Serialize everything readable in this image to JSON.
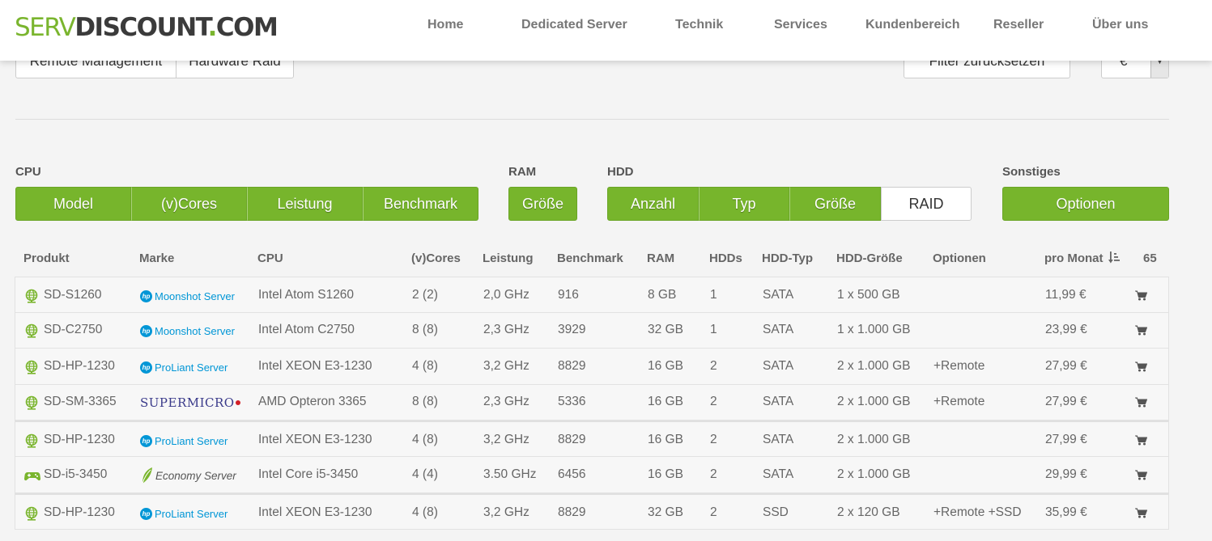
{
  "logo": {
    "part1": "SERV",
    "part2": "DISCOUNT",
    "part3": ".",
    "part4": "COM"
  },
  "nav": [
    "Home",
    "Dedicated Server",
    "Technik",
    "Services",
    "Kundenbereich",
    "Reseller",
    "Über uns"
  ],
  "top_filters": {
    "remote": "Remote Management",
    "raid": "Hardware Raid",
    "reset": "Filter zurücksetzen",
    "currency": "€"
  },
  "groups": {
    "cpu": "CPU",
    "ram": "RAM",
    "hdd": "HDD",
    "misc": "Sonstiges"
  },
  "buttons": {
    "cpu": [
      "Model",
      "(v)Cores",
      "Leistung",
      "Benchmark"
    ],
    "ram": [
      "Größe"
    ],
    "hdd": [
      "Anzahl",
      "Typ",
      "Größe",
      "RAID"
    ],
    "misc": [
      "Optionen"
    ]
  },
  "table": {
    "headers": {
      "produkt": "Produkt",
      "marke": "Marke",
      "cpu": "CPU",
      "cores": "(v)Cores",
      "leistung": "Leistung",
      "benchmark": "Benchmark",
      "ram": "RAM",
      "hdds": "HDDs",
      "hddtyp": "HDD-Typ",
      "hddgroesse": "HDD-Größe",
      "optionen": "Optionen",
      "preis": "pro Monat",
      "count": "65"
    },
    "rows": [
      {
        "icon": "globe-icon",
        "name": "SD-S1260",
        "brand_type": "hp",
        "brand": "Moonshot Server",
        "cpu": "Intel Atom S1260",
        "cores": "2 (2)",
        "leistung": "2,0 GHz",
        "benchmark": "916",
        "ram": "8 GB",
        "hdds": "1",
        "hddtyp": "SATA",
        "hddgroesse": "1 x 500 GB",
        "optionen": "",
        "preis": "11,99 €"
      },
      {
        "icon": "globe-icon",
        "name": "SD-C2750",
        "brand_type": "hp",
        "brand": "Moonshot Server",
        "cpu": "Intel Atom C2750",
        "cores": "8 (8)",
        "leistung": "2,3 GHz",
        "benchmark": "3929",
        "ram": "32 GB",
        "hdds": "1",
        "hddtyp": "SATA",
        "hddgroesse": "1 x 1.000 GB",
        "optionen": "",
        "preis": "23,99 €"
      },
      {
        "icon": "globe-icon",
        "name": "SD-HP-1230",
        "brand_type": "hp",
        "brand": "ProLiant Server",
        "cpu": "Intel XEON E3-1230",
        "cores": "4 (8)",
        "leistung": "3,2 GHz",
        "benchmark": "8829",
        "ram": "16 GB",
        "hdds": "2",
        "hddtyp": "SATA",
        "hddgroesse": "2 x 1.000 GB",
        "optionen": "+Remote",
        "preis": "27,99 €"
      },
      {
        "icon": "globe-icon",
        "name": "SD-SM-3365",
        "brand_type": "sm",
        "brand": "SUPERMICRO",
        "cpu": "AMD Opteron 3365",
        "cores": "8 (8)",
        "leistung": "2,3 GHz",
        "benchmark": "5336",
        "ram": "16 GB",
        "hdds": "2",
        "hddtyp": "SATA",
        "hddgroesse": "2 x 1.000 GB",
        "optionen": "+Remote",
        "preis": "27,99 €"
      },
      {
        "icon": "globe-icon",
        "name": "SD-HP-1230",
        "brand_type": "hp",
        "brand": "ProLiant Server",
        "cpu": "Intel XEON E3-1230",
        "cores": "4 (8)",
        "leistung": "3,2 GHz",
        "benchmark": "8829",
        "ram": "16 GB",
        "hdds": "2",
        "hddtyp": "SATA",
        "hddgroesse": "2 x 1.000 GB",
        "optionen": "",
        "preis": "27,99 €"
      },
      {
        "icon": "gamepad-icon",
        "name": "SD-i5-3450",
        "brand_type": "eco",
        "brand": "Economy Server",
        "cpu": "Intel Core i5-3450",
        "cores": "4 (4)",
        "leistung": "3.50 GHz",
        "benchmark": "6456",
        "ram": "16 GB",
        "hdds": "2",
        "hddtyp": "SATA",
        "hddgroesse": "2 x 1.000 GB",
        "optionen": "",
        "preis": "29,99 €"
      },
      {
        "icon": "globe-icon",
        "name": "SD-HP-1230",
        "brand_type": "hp",
        "brand": "ProLiant Server",
        "cpu": "Intel XEON E3-1230",
        "cores": "4 (8)",
        "leistung": "3,2 GHz",
        "benchmark": "8829",
        "ram": "32 GB",
        "hdds": "2",
        "hddtyp": "SSD",
        "hddgroesse": "2 x 120 GB",
        "optionen": "+Remote +SSD",
        "preis": "35,99 €"
      }
    ]
  },
  "colors": {
    "accent_green": "#77b52c",
    "hp_blue": "#0096d6",
    "supermicro_red": "#d21f26",
    "supermicro_blue": "#3a3a8a"
  }
}
